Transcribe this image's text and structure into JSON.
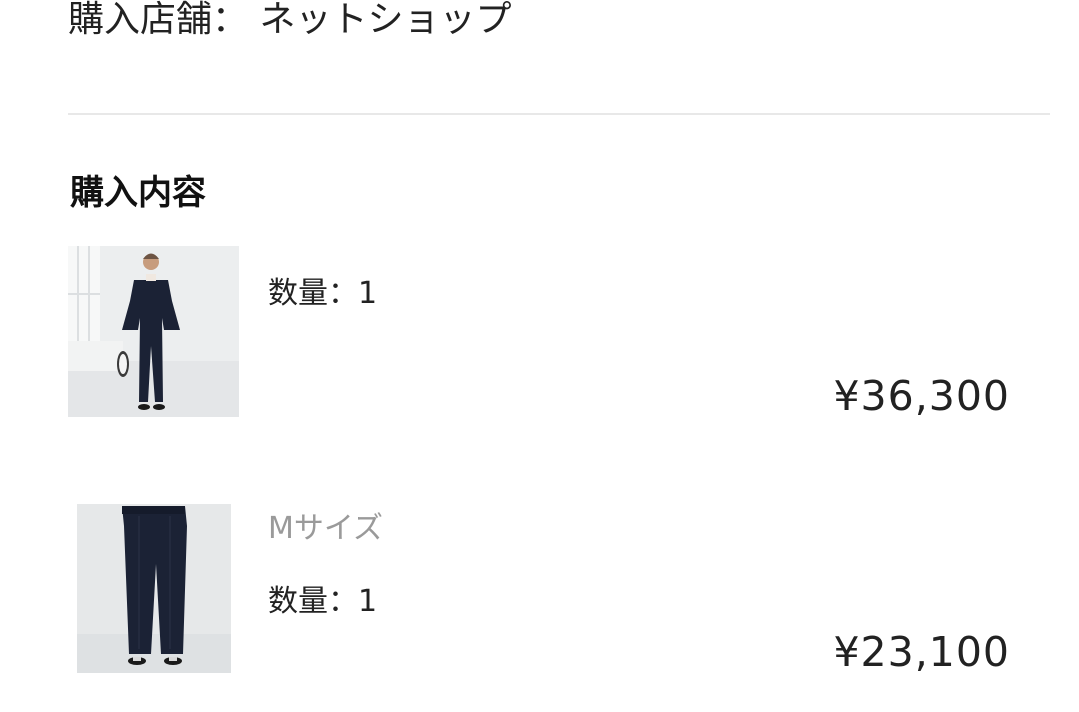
{
  "store": {
    "label": "購入店舗：",
    "name": "ネットショップ"
  },
  "section": {
    "title": "購入内容"
  },
  "items": [
    {
      "thumbnail_icon": "jacket-pants-setup-photo",
      "variant": "",
      "quantity_label": "数量：",
      "quantity": "1",
      "price": "¥36,300"
    },
    {
      "thumbnail_icon": "tapered-pants-photo",
      "variant": "Mサイズ",
      "quantity_label": "数量：",
      "quantity": "1",
      "price": "¥23,100"
    }
  ],
  "colors": {
    "text": "#222222",
    "muted": "#9a9a9a",
    "divider": "#e8e8e8",
    "garment_navy": "#1b2235"
  }
}
